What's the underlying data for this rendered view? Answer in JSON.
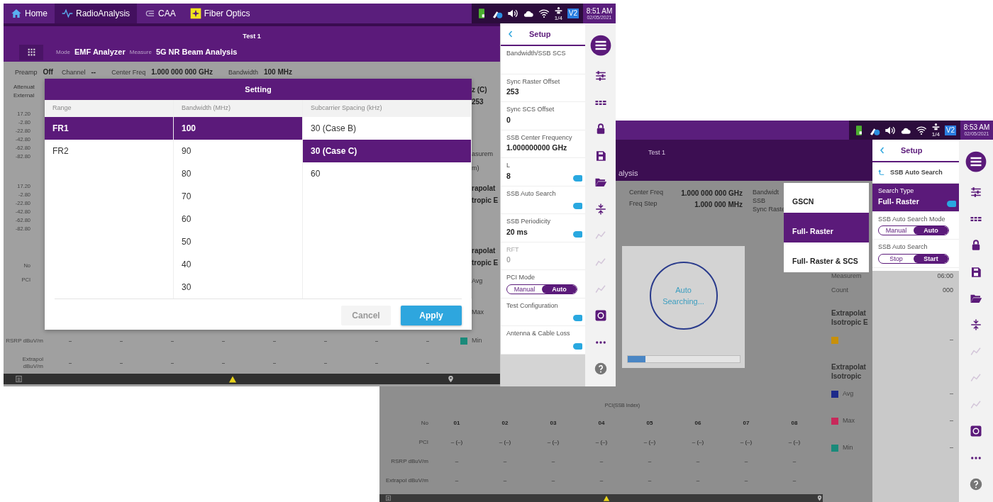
{
  "front_screen": {
    "tabs": [
      {
        "label": "Home",
        "selected": false
      },
      {
        "label": "RadioAnalysis",
        "selected": true
      },
      {
        "label": "CAA",
        "selected": false
      },
      {
        "label": "Fiber Optics",
        "selected": false
      }
    ],
    "status": {
      "badge": "V2",
      "network_count": "1/4",
      "time": "8:51 AM",
      "date": "02/05/2021"
    },
    "header": {
      "title": "Test 1",
      "mode_label": "Mode",
      "mode": "EMF Analyzer",
      "measure_label": "Measure",
      "measure": "5G NR Beam Analysis"
    },
    "params": [
      {
        "label": "Preamp",
        "value": "Off"
      },
      {
        "label": "Channel",
        "value": "--"
      },
      {
        "label": "Center Freq",
        "value": "1.000 000 000 GHz"
      },
      {
        "label": "Bandwidth",
        "value": "100 MHz"
      }
    ],
    "left_labels": [
      "Attenuat",
      "External"
    ],
    "y_axes": [
      [
        "17.20",
        "-2.80",
        "-22.80",
        "-42.80",
        "-62.80",
        "-82.80"
      ],
      [
        "17.20",
        "-2.80",
        "-22.80",
        "-42.80",
        "-62.80",
        "-82.80"
      ]
    ],
    "row_labels": [
      "No",
      "PCI"
    ],
    "right_fragments": [
      {
        "kind": "bold",
        "text": "z (C)"
      },
      {
        "kind": "bold",
        "text": "253"
      },
      {
        "kind": "plain",
        "text": "asurem"
      },
      {
        "kind": "plain",
        "text": "m)"
      },
      {
        "kind": "bold",
        "text": "rapolat"
      },
      {
        "kind": "bold",
        "text": "tropic E"
      },
      {
        "kind": "bold",
        "text": "rapolat"
      },
      {
        "kind": "bold",
        "text": "tropic E"
      },
      {
        "kind": "plain",
        "text": "Avg"
      },
      {
        "kind": "plain",
        "text": "Max"
      }
    ],
    "table_rows": [
      {
        "label": "RSRP dBuV/m",
        "cells": [
          "–",
          "–",
          "–",
          "–",
          "–",
          "–",
          "–",
          "–"
        ]
      },
      {
        "label": "Extrapol dBuV/m",
        "cells": [
          "–",
          "–",
          "–",
          "–",
          "–",
          "–",
          "–",
          "–"
        ]
      }
    ],
    "legend": [
      {
        "label": "Min",
        "color": "#1a8a7a"
      }
    ],
    "dialog": {
      "title": "Setting",
      "columns": [
        {
          "heading": "Range",
          "options": [
            {
              "label": "FR1",
              "selected": true
            },
            {
              "label": "FR2",
              "selected": false
            }
          ]
        },
        {
          "heading": "Bandwidth (MHz)",
          "options": [
            {
              "label": "100",
              "selected": true
            },
            {
              "label": "90",
              "selected": false
            },
            {
              "label": "80",
              "selected": false
            },
            {
              "label": "70",
              "selected": false
            },
            {
              "label": "60",
              "selected": false
            },
            {
              "label": "50",
              "selected": false
            },
            {
              "label": "40",
              "selected": false
            },
            {
              "label": "30",
              "selected": false
            }
          ]
        },
        {
          "heading": "Subcarrier Spacing (kHz)",
          "options": [
            {
              "label": "30 (Case B)",
              "selected": false
            },
            {
              "label": "30 (Case C)",
              "selected": true
            },
            {
              "label": "60",
              "selected": false
            }
          ]
        }
      ],
      "buttons": [
        {
          "label": "Cancel",
          "kind": "secondary"
        },
        {
          "label": "Apply",
          "kind": "primary"
        }
      ]
    },
    "setup": {
      "title": "Setup",
      "items": [
        {
          "kind": "value",
          "label": "Bandwidth/SSB SCS",
          "tab": false,
          "disabled": false
        },
        {
          "kind": "value",
          "label": "Sync Raster Offset",
          "value": "253",
          "tab": false,
          "disabled": false
        },
        {
          "kind": "value",
          "label": "Sync SCS Offset",
          "value": "0",
          "tab": false,
          "disabled": false
        },
        {
          "kind": "value",
          "label": "SSB Center Frequency",
          "value": "1.000000000 GHz",
          "tab": false,
          "disabled": false
        },
        {
          "kind": "value",
          "label": "L",
          "value": "8",
          "tab": true,
          "disabled": false
        },
        {
          "kind": "value",
          "label": "SSB Auto Search",
          "tab": true,
          "disabled": false
        },
        {
          "kind": "value",
          "label": "SSB Periodicity",
          "value": "20 ms",
          "tab": true,
          "disabled": false
        },
        {
          "kind": "value",
          "label": "RFT",
          "value": "0",
          "tab": false,
          "disabled": true
        },
        {
          "kind": "segmented",
          "label": "PCI Mode",
          "options": [
            {
              "label": "Manual",
              "selected": false
            },
            {
              "label": "Auto",
              "selected": true
            }
          ]
        },
        {
          "kind": "value",
          "label": "Test Configuration",
          "tab": true,
          "disabled": false
        },
        {
          "kind": "value",
          "label": "Antenna & Cable Loss",
          "tab": true,
          "disabled": false
        }
      ]
    },
    "rail": [
      {
        "disabled": false
      },
      {
        "disabled": false
      },
      {
        "disabled": false
      },
      {
        "disabled": false
      },
      {
        "disabled": false
      },
      {
        "disabled": false
      },
      {
        "disabled": false
      },
      {
        "disabled": true
      },
      {
        "disabled": true
      },
      {
        "disabled": true
      },
      {
        "disabled": false
      },
      {
        "disabled": false
      },
      {
        "disabled": false
      }
    ]
  },
  "back_screen": {
    "status": {
      "badge": "V2",
      "network_count": "1/4",
      "time": "8:53 AM",
      "date": "02/05/2021"
    },
    "header": {
      "title": "Test 1",
      "measure": "alysis"
    },
    "params": [
      {
        "label": "Center Freq",
        "value": "1.000 000 000 GHz"
      },
      {
        "label": "Freq Step",
        "value": "1.000 000 MHz"
      }
    ],
    "params_right": [
      "Bandwidt",
      "SSB",
      "Sync Raste"
    ],
    "dropdown": [
      {
        "label": "GSCN",
        "selected": false
      },
      {
        "label": "Full- Raster",
        "selected": true
      },
      {
        "label": "Full- Raster & SCS",
        "selected": false
      }
    ],
    "search": {
      "label": "Auto Searching...",
      "level": 0.16
    },
    "stats": [
      {
        "label": "Measurem",
        "value": "06:00"
      },
      {
        "label": "Count",
        "value": "000"
      }
    ],
    "groups": [
      {
        "title": "Extrapolat",
        "subtitle": "Isotropic E",
        "legend": [
          {
            "color": "#c8900a",
            "value": "–"
          }
        ]
      },
      {
        "title": "Extrapolat",
        "subtitle": "Isotropic",
        "legend": [
          {
            "label": "Avg",
            "color": "#1d2a8a",
            "value": "–"
          },
          {
            "label": "Max",
            "color": "#c8285a",
            "value": "–"
          },
          {
            "label": "Min",
            "color": "#1a8a7a",
            "value": "–"
          }
        ]
      }
    ],
    "table": {
      "title": "PCI(SSB Index)",
      "rows": [
        {
          "label": "No",
          "kind": "header",
          "cells": [
            "01",
            "02",
            "03",
            "04",
            "05",
            "06",
            "07",
            "08"
          ]
        },
        {
          "label": "PCI",
          "kind": "data",
          "cells": [
            "– (–)",
            "– (–)",
            "– (–)",
            "– (–)",
            "– (–)",
            "– (–)",
            "– (–)",
            "– (–)"
          ]
        },
        {
          "label": "RSRP dBuV/m",
          "kind": "data",
          "cells": [
            "–",
            "–",
            "–",
            "–",
            "–",
            "–",
            "–",
            "–"
          ]
        },
        {
          "label": "Extrapol dBuV/m",
          "kind": "data",
          "cells": [
            "–",
            "–",
            "–",
            "–",
            "–",
            "–",
            "–",
            "–"
          ]
        }
      ]
    },
    "setup": {
      "title": "Setup",
      "subtitle": "SSB Auto Search",
      "items": [
        {
          "kind": "value",
          "label": "Search Type",
          "value": "Full- Raster",
          "tab": true,
          "selected": true
        },
        {
          "kind": "segmented",
          "label": "SSB Auto Search Mode",
          "options": [
            {
              "label": "Manual",
              "selected": false
            },
            {
              "label": "Auto",
              "selected": true
            }
          ]
        },
        {
          "kind": "segmented",
          "label": "SSB Auto Search",
          "options": [
            {
              "label": "Stop",
              "selected": false
            },
            {
              "label": "Start",
              "selected": true
            }
          ]
        }
      ]
    },
    "rail": [
      {
        "disabled": false
      },
      {
        "disabled": false
      },
      {
        "disabled": false
      },
      {
        "disabled": false
      },
      {
        "disabled": false
      },
      {
        "disabled": false
      },
      {
        "disabled": false
      },
      {
        "disabled": true
      },
      {
        "disabled": true
      },
      {
        "disabled": true
      },
      {
        "disabled": false
      },
      {
        "disabled": false
      },
      {
        "disabled": false
      }
    ]
  }
}
